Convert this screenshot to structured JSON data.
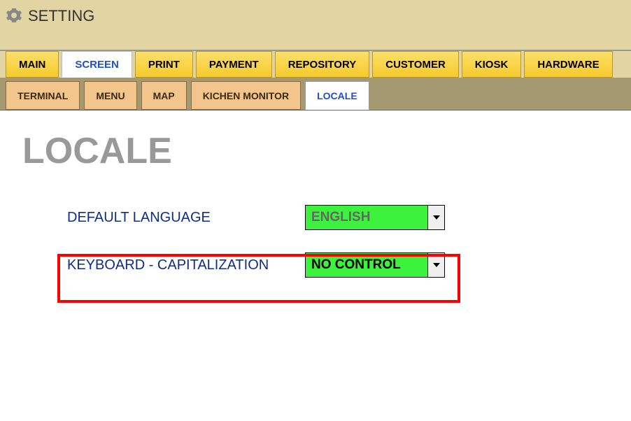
{
  "header": {
    "title": "SETTING"
  },
  "mainTabs": {
    "t0": "MAIN",
    "t1": "SCREEN",
    "t2": "PRINT",
    "t3": "PAYMENT",
    "t4": "REPOSITORY",
    "t5": "CUSTOMER",
    "t6": "KIOSK",
    "t7": "HARDWARE"
  },
  "subTabs": {
    "s0": "TERMINAL",
    "s1": "MENU",
    "s2": "MAP",
    "s3": "KICHEN MONITOR",
    "s4": "LOCALE"
  },
  "page": {
    "heading": "LOCALE"
  },
  "form": {
    "defaultLanguage": {
      "label": "DEFAULT LANGUAGE",
      "value": "ENGLISH"
    },
    "keyboardCap": {
      "label": "KEYBOARD - CAPITALIZATION",
      "value": "NO CONTROL"
    }
  }
}
